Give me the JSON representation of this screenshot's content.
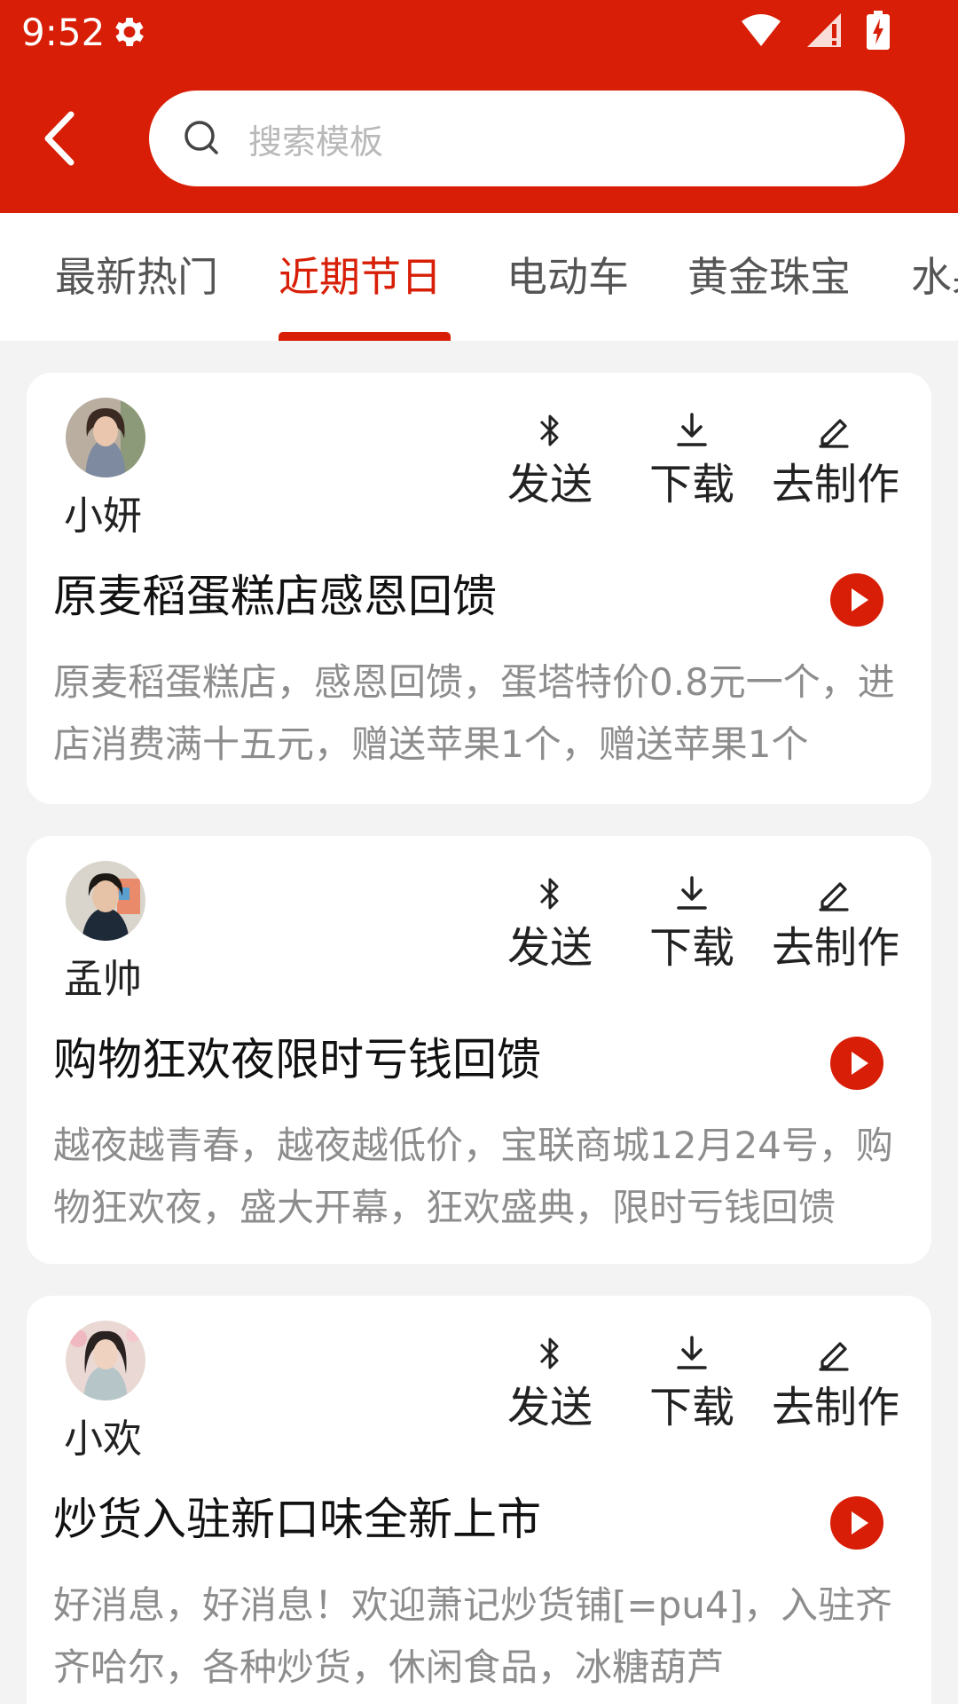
{
  "status_bar": {
    "time": "9:52"
  },
  "search": {
    "placeholder": "搜索模板"
  },
  "tabs": [
    {
      "label": "最新热门",
      "active": false
    },
    {
      "label": "近期节日",
      "active": true
    },
    {
      "label": "电动车",
      "active": false
    },
    {
      "label": "黄金珠宝",
      "active": false
    },
    {
      "label": "水果",
      "active": false
    }
  ],
  "actions": {
    "send": "发送",
    "download": "下载",
    "make": "去制作"
  },
  "cards": [
    {
      "author": "小妍",
      "title": "原麦稻蛋糕店感恩回馈",
      "description": "原麦稻蛋糕店，感恩回馈，蛋塔特价0.8元一个，进店消费满十五元，赠送苹果1个，赠送苹果1个"
    },
    {
      "author": "孟帅",
      "title": "购物狂欢夜限时亏钱回馈",
      "description": "越夜越青春，越夜越低价，宝联商城12月24号，购物狂欢夜，盛大开幕，狂欢盛典，限时亏钱回馈"
    },
    {
      "author": "小欢",
      "title": "炒货入驻新口味全新上市",
      "description": "好消息，好消息！欢迎萧记炒货铺[=pu4]，入驻齐齐哈尔，各种炒货，休闲食品，冰糖葫芦"
    }
  ],
  "colors": {
    "accent": "#d81e06",
    "background": "#f3f3f3"
  }
}
